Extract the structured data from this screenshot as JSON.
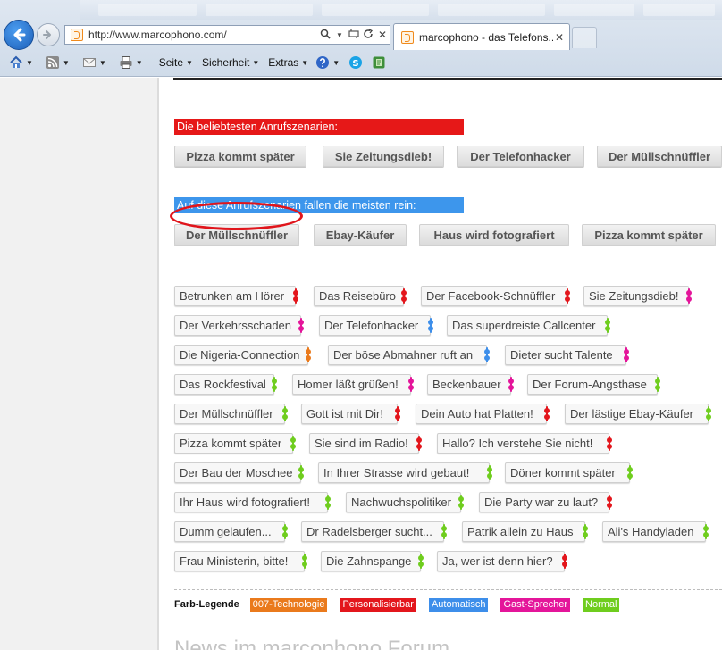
{
  "browser": {
    "url": "http://www.marcophono.com/",
    "tab_title": "marcophono - das Telefons...",
    "tab_close": "✕",
    "commands": {
      "page": "Seite",
      "safety": "Sicherheit",
      "extras": "Extras"
    }
  },
  "page": {
    "popular_label": "Die beliebtesten Anrufszenarien:",
    "popular_buttons": [
      "Pizza kommt später",
      "Sie Zeitungsdieb!",
      "Der Telefonhacker",
      "Der Müllschnüffler"
    ],
    "fooled_label": "Auf diese Anrufszenarien fallen die meisten rein:",
    "fooled_buttons": [
      "Der Müllschnüffler",
      "Ebay-Käufer",
      "Haus wird fotografiert",
      "Pizza kommt später"
    ],
    "scenario_tags": [
      {
        "label": "Betrunken am Hörer",
        "type": "personalisierbar"
      },
      {
        "label": "Das Reisebüro",
        "type": "personalisierbar"
      },
      {
        "label": "Der Facebook-Schnüffler",
        "type": "personalisierbar"
      },
      {
        "label": "Sie Zeitungsdieb!",
        "type": "gast-sprecher"
      },
      {
        "label": "Der Verkehrsschaden",
        "type": "gast-sprecher"
      },
      {
        "label": "Der Telefonhacker",
        "type": "automatisch"
      },
      {
        "label": "Das superdreiste Callcenter",
        "type": "normal"
      },
      {
        "label": "Die Nigeria-Connection",
        "type": "007-technologie"
      },
      {
        "label": "Der böse Abmahner ruft an",
        "type": "automatisch"
      },
      {
        "label": "Dieter sucht Talente",
        "type": "gast-sprecher"
      },
      {
        "label": "Das Rockfestival",
        "type": "normal"
      },
      {
        "label": "Homer läßt grüßen!",
        "type": "gast-sprecher"
      },
      {
        "label": "Beckenbauer",
        "type": "gast-sprecher"
      },
      {
        "label": "Der Forum-Angsthase",
        "type": "normal"
      },
      {
        "label": "Der Müllschnüffler",
        "type": "normal"
      },
      {
        "label": "Gott ist mit Dir!",
        "type": "personalisierbar"
      },
      {
        "label": "Dein Auto hat Platten!",
        "type": "personalisierbar"
      },
      {
        "label": "Der lästige Ebay-Käufer",
        "type": "normal"
      },
      {
        "label": "Pizza kommt später",
        "type": "normal"
      },
      {
        "label": "Sie sind im Radio!",
        "type": "personalisierbar"
      },
      {
        "label": "Hallo? Ich verstehe Sie nicht!",
        "type": "personalisierbar"
      },
      {
        "label": "Der Bau der Moschee",
        "type": "normal"
      },
      {
        "label": "In Ihrer Strasse wird gebaut!",
        "type": "normal"
      },
      {
        "label": "Döner kommt später",
        "type": "normal"
      },
      {
        "label": "Ihr Haus wird fotografiert!",
        "type": "normal"
      },
      {
        "label": "Nachwuchspolitiker",
        "type": "normal"
      },
      {
        "label": "Die Party war zu laut?",
        "type": "personalisierbar"
      },
      {
        "label": "Dumm gelaufen...",
        "type": "normal"
      },
      {
        "label": "Dr Radelsberger sucht...",
        "type": "normal"
      },
      {
        "label": "Patrik allein zu Haus",
        "type": "normal"
      },
      {
        "label": "Ali's Handyladen",
        "type": "normal"
      },
      {
        "label": "Frau Ministerin, bitte!",
        "type": "normal"
      },
      {
        "label": "Die Zahnspange",
        "type": "normal"
      },
      {
        "label": "Ja, wer ist denn hier?",
        "type": "personalisierbar"
      }
    ],
    "legend": {
      "title": "Farb-Legende",
      "items": [
        {
          "label": "007-Technologie",
          "color": "#ea7a1c"
        },
        {
          "label": "Personalisierbar",
          "color": "#e3161c"
        },
        {
          "label": "Automatisch",
          "color": "#3d8eea"
        },
        {
          "label": "Gast-Sprecher",
          "color": "#e4159a"
        },
        {
          "label": "Normal",
          "color": "#6fcd1e"
        }
      ]
    },
    "forum_heading": "News im marcophono Forum"
  },
  "colors": {
    "popular_label_bg": "#e61818",
    "fooled_label_bg": "#3d96ec",
    "007-technologie": "#ea7a1c",
    "personalisierbar": "#e3161c",
    "automatisch": "#3d8eea",
    "gast-sprecher": "#e4159a",
    "normal": "#6fcd1e"
  },
  "icons": [
    "back-arrow-icon",
    "forward-arrow-icon",
    "favicon-icon",
    "search-icon",
    "compatibility-icon",
    "refresh-icon",
    "home-icon",
    "rss-icon",
    "mail-icon",
    "print-icon",
    "help-icon",
    "skype-icon",
    "evernote-icon"
  ]
}
